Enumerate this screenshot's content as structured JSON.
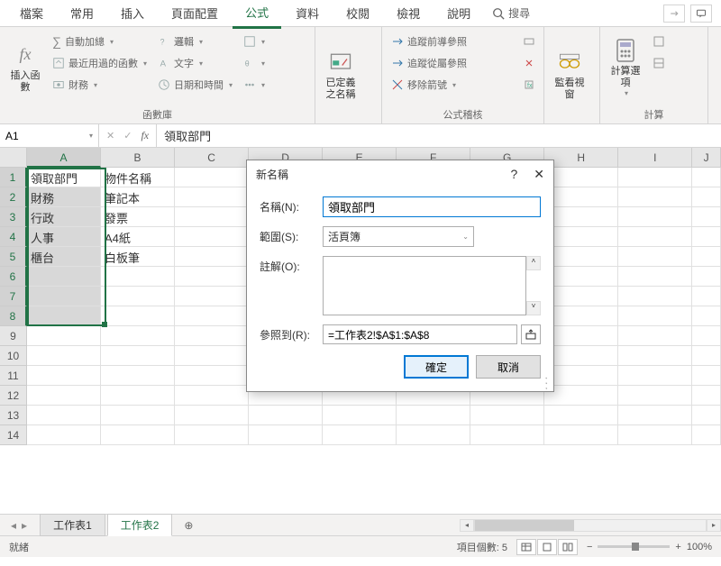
{
  "ribbon": {
    "tabs": [
      "檔案",
      "常用",
      "插入",
      "頁面配置",
      "公式",
      "資料",
      "校閱",
      "檢視",
      "說明"
    ],
    "active_tab_index": 4,
    "search_label": "搜尋",
    "groups": {
      "insert_fn": "插入函數",
      "autosum": "自動加總",
      "recent": "最近用過的函數",
      "financial": "財務",
      "logical": "邏輯",
      "text": "文字",
      "datetime": "日期和時間",
      "lib_label": "函數庫",
      "name_mgr": "已定義之名稱",
      "trace_prec": "追蹤前導參照",
      "trace_dep": "追蹤從屬參照",
      "remove_arrows": "移除箭號",
      "audit_label": "公式稽核",
      "watch": "監看視窗",
      "calc_opts": "計算選項",
      "calc_label": "計算"
    }
  },
  "formula_bar": {
    "name_box": "A1",
    "formula": "領取部門"
  },
  "grid": {
    "columns": [
      "A",
      "B",
      "C",
      "D",
      "E",
      "F",
      "G",
      "H",
      "I",
      "J"
    ],
    "selected_col": "A",
    "selected_rows": [
      1,
      2,
      3,
      4,
      5,
      6,
      7,
      8
    ],
    "rows": [
      {
        "n": 1,
        "A": "領取部門",
        "B": "物件名稱"
      },
      {
        "n": 2,
        "A": "財務",
        "B": "筆記本"
      },
      {
        "n": 3,
        "A": "行政",
        "B": "發票"
      },
      {
        "n": 4,
        "A": "人事",
        "B": "A4紙"
      },
      {
        "n": 5,
        "A": "櫃台",
        "B": "白板筆"
      },
      {
        "n": 6,
        "A": "",
        "B": ""
      },
      {
        "n": 7,
        "A": "",
        "B": ""
      },
      {
        "n": 8,
        "A": "",
        "B": ""
      },
      {
        "n": 9,
        "A": "",
        "B": ""
      },
      {
        "n": 10,
        "A": "",
        "B": ""
      },
      {
        "n": 11,
        "A": "",
        "B": ""
      },
      {
        "n": 12,
        "A": "",
        "B": ""
      },
      {
        "n": 13,
        "A": "",
        "B": ""
      },
      {
        "n": 14,
        "A": "",
        "B": ""
      }
    ]
  },
  "sheets": {
    "tabs": [
      "工作表1",
      "工作表2"
    ],
    "active_index": 1
  },
  "dialog": {
    "title": "新名稱",
    "labels": {
      "name": "名稱(N):",
      "scope": "範圍(S):",
      "comment": "註解(O):",
      "refers_to": "參照到(R):"
    },
    "name_value": "領取部門",
    "scope_value": "活頁簿",
    "comment_value": "",
    "refers_to_value": "=工作表2!$A$1:$A$8",
    "ok": "確定",
    "cancel": "取消"
  },
  "status": {
    "ready": "就緒",
    "count_label": "項目個數:",
    "count_value": "5",
    "zoom": "100%"
  }
}
